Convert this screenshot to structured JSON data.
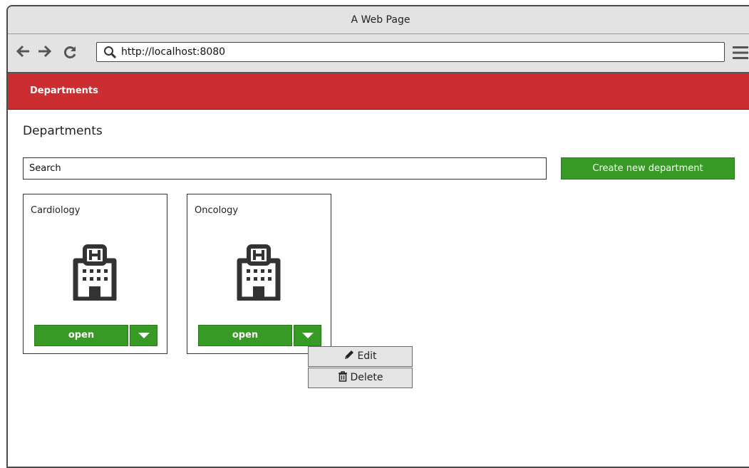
{
  "window": {
    "title": "A Web Page"
  },
  "browser": {
    "url": "http://localhost:8080"
  },
  "app": {
    "brand": "Departments",
    "accent": "#cc2d30"
  },
  "page": {
    "heading": "Departments",
    "search_placeholder": "Search",
    "create_label": "Create new department",
    "button_color": "#379a25"
  },
  "departments": [
    {
      "name": "Cardiology",
      "icon": "hospital-building-icon",
      "open_label": "open"
    },
    {
      "name": "Oncology",
      "icon": "hospital-building-icon",
      "open_label": "open"
    }
  ],
  "dropdown_menu": {
    "items": [
      {
        "label": "Edit",
        "icon": "pencil-icon"
      },
      {
        "label": "Delete",
        "icon": "trash-icon"
      }
    ]
  }
}
